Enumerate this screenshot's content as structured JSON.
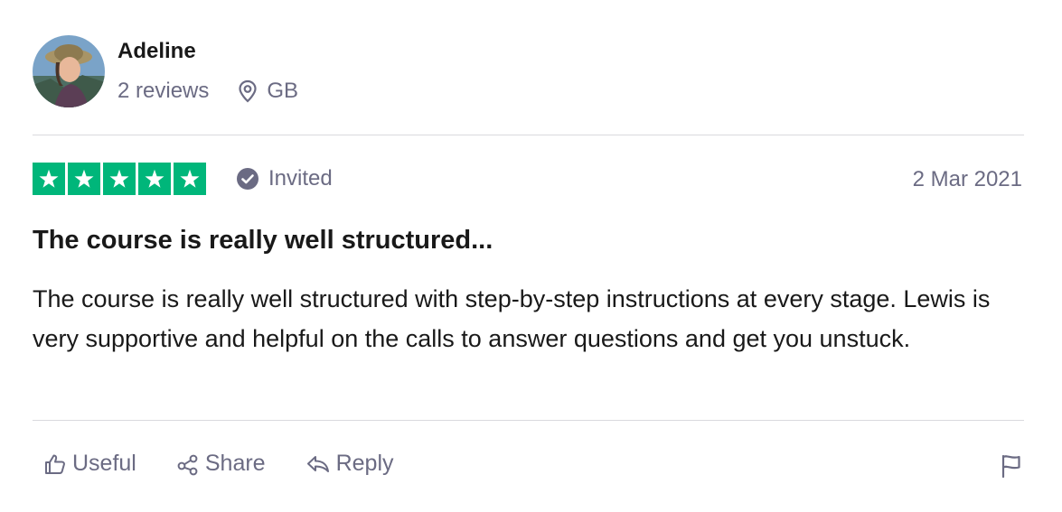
{
  "reviewer": {
    "name": "Adeline",
    "review_count": "2 reviews",
    "location": "GB",
    "avatar_icon": "user-photo"
  },
  "rating": {
    "stars": 5,
    "max": 5,
    "color": "#00b67a",
    "badge": "Invited",
    "date": "2 Mar 2021"
  },
  "review": {
    "title": "The course is really well structured...",
    "body": "The course is really well structured with step-by-step instructions at every stage. Lewis is very supportive and helpful on the calls to answer questions and get you unstuck."
  },
  "actions": {
    "useful": "Useful",
    "share": "Share",
    "reply": "Reply",
    "report_icon": "flag-icon"
  },
  "colors": {
    "text": "#191919",
    "muted": "#6b6b83",
    "divider": "#d9d9de"
  }
}
